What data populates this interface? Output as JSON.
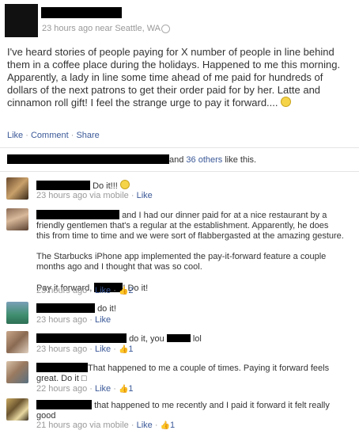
{
  "post": {
    "meta_time": "23 hours ago near Seattle, WA",
    "body_lines": [
      "I've heard stories of people paying for X number of people in line behind",
      "them in a coffee place during the holidays. Happened to me this morning.",
      "Apparently, a lady in line some time ahead of me paid for hundreds of",
      "dollars of the next patrons to get their order paid for by her. Latte and",
      "cinnamon roll gift! I feel the strange urge to pay it forward...."
    ],
    "actions": {
      "like": "Like",
      "comment": "Comment",
      "share": "Share",
      "sep": " · "
    }
  },
  "likes": {
    "and_text": "and ",
    "others_link": "36 others",
    "suffix": " like this."
  },
  "comments": [
    {
      "text": "Do it!!!",
      "meta": "23 hours ago via mobile · ",
      "like": "Like"
    },
    {
      "lines": [
        "and I had our dinner paid for at a nice restaurant by a",
        "friendly gentlemen that's a regular at the establishment. Apparently, he does",
        "this from time to time and we were sort of flabbergasted at the amazing gesture."
      ],
      "para2": [
        "The Starbucks iPhone app implemented the pay-it-forward feature a couple",
        "months ago and I thought that was so cool."
      ],
      "para3_a": "Pay it forward,",
      "para3_b": "! Do it!",
      "meta": "23 hours ago · ",
      "like": "Like",
      "count": "2"
    },
    {
      "text": "do it!",
      "meta": "23 hours ago · ",
      "like": "Like"
    },
    {
      "text_a": "do it, you",
      "text_b": "lol",
      "meta": "23 hours ago · ",
      "like": "Like",
      "count": "1"
    },
    {
      "line1": "That happened to me a couple of times. Paying it forward feels",
      "line2": "great. Do it □",
      "meta": "22 hours ago · ",
      "like": "Like",
      "count": "1"
    },
    {
      "line1": "that happened to me recently and I paid it forward it felt really",
      "line2": "good",
      "meta": "21 hours ago via mobile · ",
      "like": "Like",
      "count": "1"
    }
  ],
  "colors": {
    "link": "#3b5998",
    "meta": "#999999",
    "divider": "#e5e5e5",
    "comment_bg": "#edeff4"
  }
}
